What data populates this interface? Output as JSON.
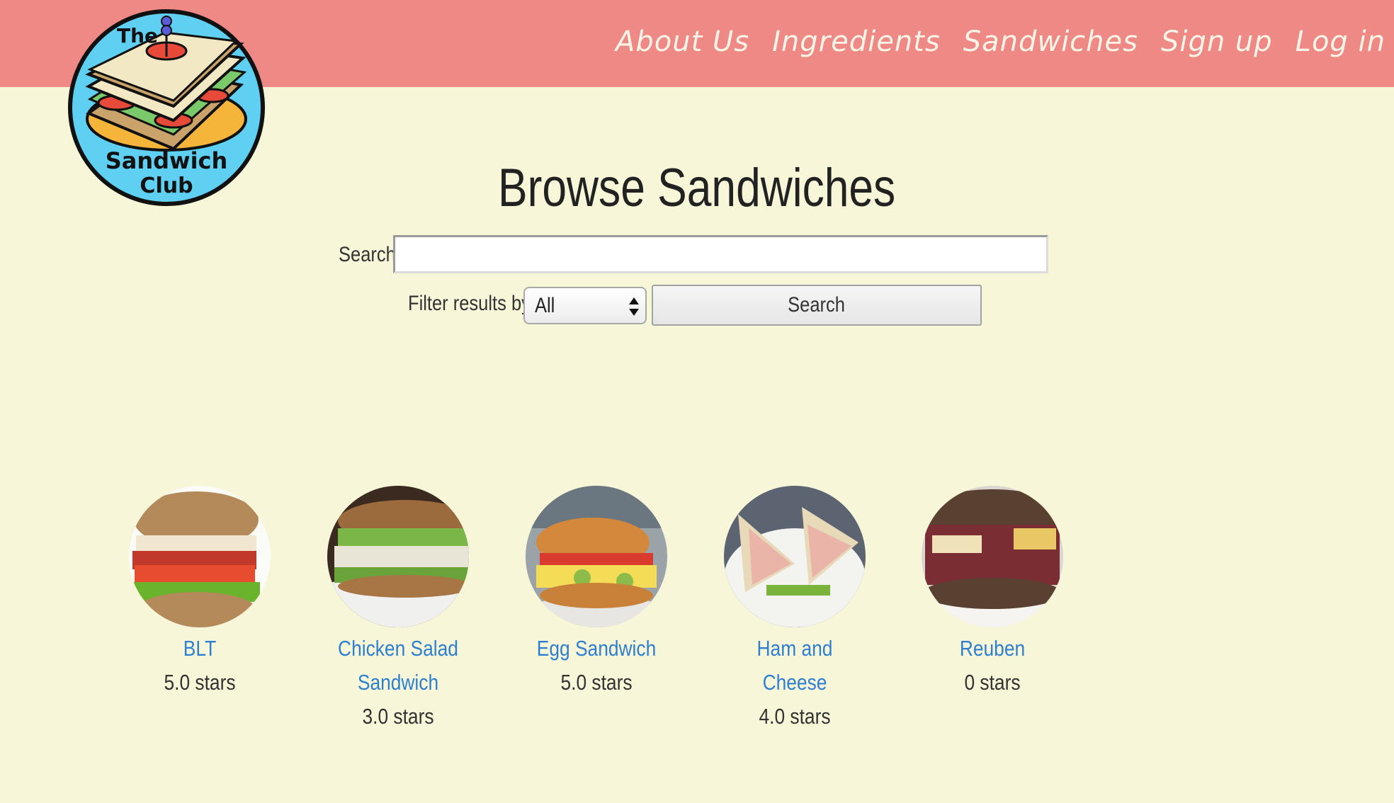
{
  "nav": {
    "items": [
      {
        "label": "About Us"
      },
      {
        "label": "Ingredients"
      },
      {
        "label": "Sandwiches"
      },
      {
        "label": "Sign up"
      },
      {
        "label": "Log in"
      }
    ]
  },
  "logo": {
    "line1": "The",
    "line2": "Sandwich",
    "line3": "Club"
  },
  "page": {
    "title": "Browse Sandwiches"
  },
  "search": {
    "label": "Search",
    "value": "",
    "filter_label": "Filter results by",
    "filter_selected": "All",
    "button_label": "Search"
  },
  "sandwiches": [
    {
      "name": "BLT",
      "rating": "5.0 stars",
      "icon": "blt-photo"
    },
    {
      "name": "Chicken Salad Sandwich",
      "rating": "3.0 stars",
      "icon": "chicken-salad-photo"
    },
    {
      "name": "Egg Sandwich",
      "rating": "5.0 stars",
      "icon": "egg-sandwich-photo"
    },
    {
      "name": "Ham and Cheese",
      "rating": "4.0 stars",
      "icon": "ham-and-cheese-photo"
    },
    {
      "name": "Reuben",
      "rating": "0 stars",
      "icon": "reuben-photo"
    }
  ],
  "colors": {
    "header": "#ee8986",
    "background": "#f7f6d8",
    "link": "#2f7fd0"
  }
}
